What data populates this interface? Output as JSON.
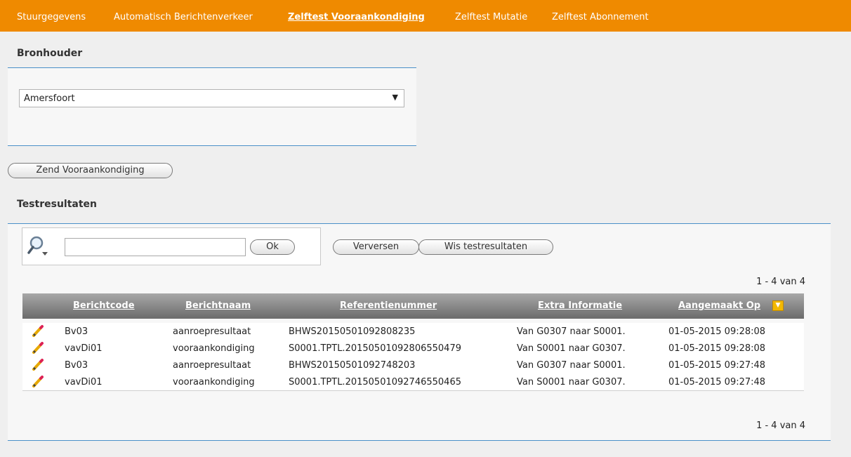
{
  "nav": {
    "items": [
      {
        "label": "Stuurgegevens"
      },
      {
        "label": "Automatisch Berichtenverkeer"
      },
      {
        "label": "Zelftest Vooraankondiging"
      },
      {
        "label": "Zelftest Mutatie"
      },
      {
        "label": "Zelftest Abonnement"
      }
    ],
    "active_index": 2
  },
  "bronhouder": {
    "title": "Bronhouder",
    "selected": "Amersfoort"
  },
  "actions": {
    "send_label": "Zend Vooraankondiging"
  },
  "testresultaten": {
    "title": "Testresultaten",
    "search": {
      "value": "",
      "ok_label": "Ok"
    },
    "refresh_label": "Verversen",
    "clear_label": "Wis testresultaten",
    "pager_top": "1 - 4 van 4",
    "pager_bottom": "1 - 4 van 4",
    "columns": [
      "Berichtcode",
      "Berichtnaam",
      "Referentienummer",
      "Extra Informatie",
      "Aangemaakt Op"
    ],
    "rows": [
      {
        "code": "Bv03",
        "naam": "aanroepresultaat",
        "ref": "BHWS20150501092808235",
        "extra": "Van G0307 naar S0001.",
        "datum": "01-05-2015 09:28:08"
      },
      {
        "code": "vavDi01",
        "naam": "vooraankondiging",
        "ref": "S0001.TPTL.20150501092806550479",
        "extra": "Van S0001 naar G0307.",
        "datum": "01-05-2015 09:28:08"
      },
      {
        "code": "Bv03",
        "naam": "aanroepresultaat",
        "ref": "BHWS20150501092748203",
        "extra": "Van G0307 naar S0001.",
        "datum": "01-05-2015 09:27:48"
      },
      {
        "code": "vavDi01",
        "naam": "vooraankondiging",
        "ref": "S0001.TPTL.20150501092746550465",
        "extra": "Van S0001 naar G0307.",
        "datum": "01-05-2015 09:27:48"
      }
    ]
  },
  "colors": {
    "nav": "#ef8a00",
    "accent_line": "#4a90c8"
  }
}
